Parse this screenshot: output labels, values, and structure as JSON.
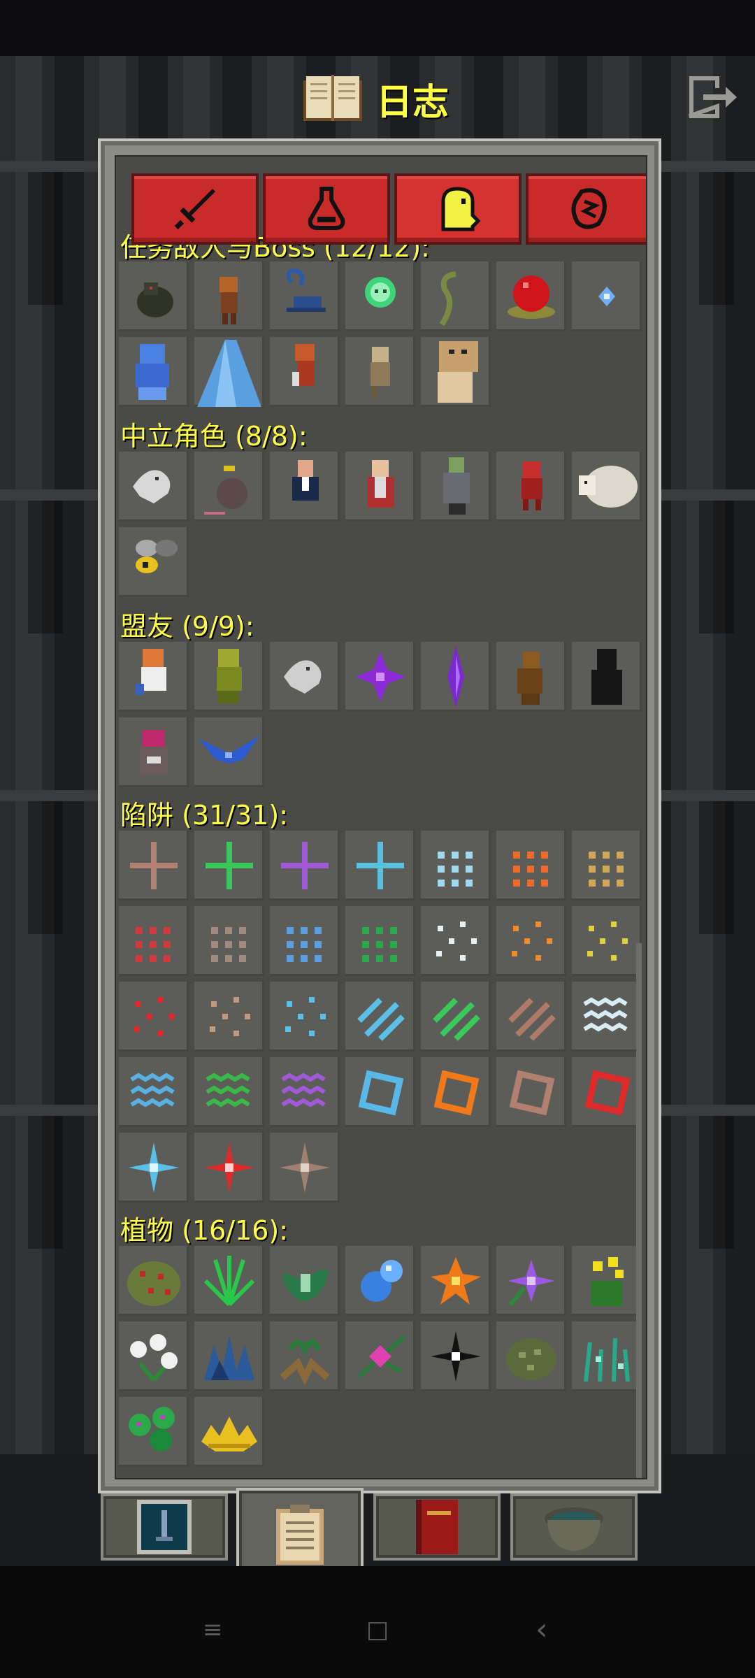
{
  "title": "日志",
  "icons": {
    "title": "journal-book-icon",
    "exit": "exit-icon",
    "tabs": [
      "sword-icon",
      "potion-icon",
      "ghost-icon",
      "rune-stone-icon"
    ],
    "bottom_tabs": [
      "guide-card-icon",
      "clipboard-icon",
      "red-book-icon",
      "alchemy-pot-icon"
    ],
    "nav": [
      "menu-icon",
      "home-icon",
      "back-icon"
    ]
  },
  "tabs": {
    "active_index": 2
  },
  "bottom_tabs": {
    "active_index": 1
  },
  "sections": [
    {
      "key": "quest",
      "heading": "任务敌人与Boss (12/12):"
    },
    {
      "key": "neutral",
      "heading": "中立角色 (8/8):"
    },
    {
      "key": "allies",
      "heading": "盟友 (9/9):"
    },
    {
      "key": "traps",
      "heading": "陷阱 (31/31):"
    },
    {
      "key": "plants",
      "heading": "植物 (16/16):"
    }
  ],
  "nav": {
    "menu": "≡",
    "home": "□",
    "back": "‹"
  }
}
